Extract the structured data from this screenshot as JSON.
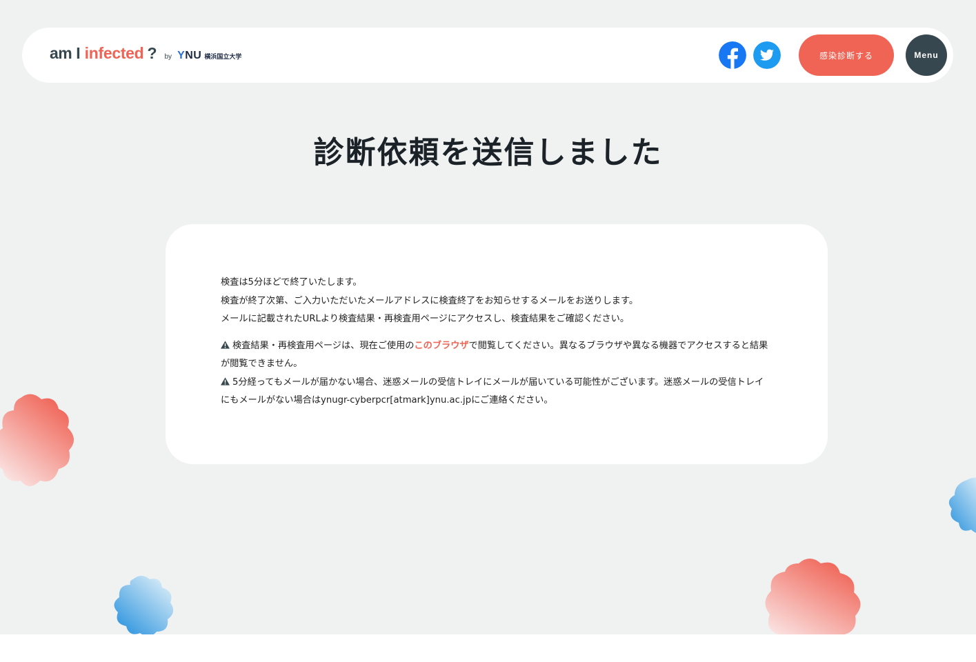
{
  "header": {
    "logo": {
      "am": "am",
      "i": "I",
      "infected": "infected",
      "question": "?",
      "by": "by",
      "ynu_y": "Y",
      "ynu_rest": "NU",
      "university": "横浜国立大学"
    },
    "diagnose_button": "感染診断する",
    "menu_button": "Menu"
  },
  "page_title": "診断依頼を送信しました",
  "card": {
    "lines": [
      "検査は5分ほどで終了いたします。",
      "検査が終了次第、ご入力いただいたメールアドレスに検査終了をお知らせするメールをお送りします。",
      "メールに記載されたURLより検査結果・再検査用ページにアクセスし、検査結果をご確認ください。"
    ],
    "note1_pre": "検査結果・再検査用ページは、現在ご使用の",
    "note1_link": "このブラウザ",
    "note1_post": "で閲覧してください。異なるブラウザや異なる機器でアクセスすると結果が閲覧できません。",
    "note2": "5分経ってもメールが届かない場合、迷惑メールの受信トレイにメールが届いている可能性がございます。迷惑メールの受信トレイにもメールがない場合はynugr-cyberpcr[atmark]ynu.ac.jpにご連絡ください。"
  },
  "icons": {
    "facebook": "facebook-icon",
    "twitter": "twitter-icon",
    "warning": "warning-icon"
  },
  "colors": {
    "accent": "#ef6455",
    "dark": "#37474f",
    "background": "#f0f1f1",
    "facebook": "#1877f2",
    "twitter": "#1d9bf0"
  }
}
